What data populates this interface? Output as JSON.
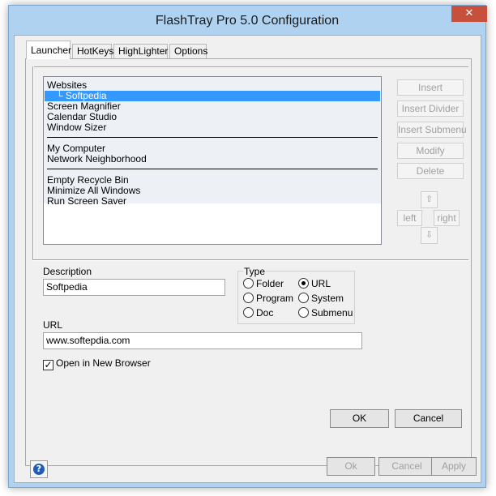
{
  "window": {
    "title": "FlashTray Pro 5.0 Configuration",
    "close_glyph": "✕"
  },
  "tabs": [
    {
      "label": "Launcher",
      "active": true
    },
    {
      "label": "HotKeys",
      "active": false
    },
    {
      "label": "HighLighter",
      "active": false
    },
    {
      "label": "Options",
      "active": false
    }
  ],
  "launcher_list": {
    "items": [
      {
        "label": "Websites"
      },
      {
        "label": "Softpedia",
        "prefix": "└",
        "selected": true
      },
      {
        "label": "Screen Magnifier"
      },
      {
        "label": "Calendar Studio"
      },
      {
        "label": "Window Sizer"
      },
      {
        "label": "My Computer"
      },
      {
        "label": "Network Neighborhood"
      },
      {
        "label": "Empty Recycle Bin"
      },
      {
        "label": "Minimize All Windows"
      },
      {
        "label": "Run Screen Saver"
      }
    ]
  },
  "side_buttons": {
    "insert": "Insert",
    "insert_divider": "Insert Divider",
    "insert_submenu": "Insert Submenu",
    "modify": "Modify",
    "delete": "Delete",
    "move_up_icon": "up-arrow-icon",
    "left": "left",
    "right": "right",
    "move_down_icon": "down-arrow-icon"
  },
  "form": {
    "description_label": "Description",
    "description_value": "Softpedia",
    "url_label": "URL",
    "url_value": "www.softepdia.com",
    "open_new_browser_label": "Open in New Browser",
    "open_new_browser_checked": true
  },
  "type_group": {
    "label": "Type",
    "options": [
      {
        "label": "Folder",
        "checked": false
      },
      {
        "label": "URL",
        "checked": true
      },
      {
        "label": "Program",
        "checked": false
      },
      {
        "label": "System",
        "checked": false
      },
      {
        "label": "Doc",
        "checked": false
      },
      {
        "label": "Submenu",
        "checked": false
      }
    ]
  },
  "panel_buttons": {
    "ok": "OK",
    "cancel": "Cancel"
  },
  "bottom_buttons": {
    "ok": "Ok",
    "cancel": "Cancel",
    "apply": "Apply"
  },
  "help": {
    "glyph": "?"
  },
  "colors": {
    "window_frame": "#aed2f0",
    "selection": "#3399ff",
    "help_icon": "#1e5db5",
    "close_button": "#c7503c"
  }
}
